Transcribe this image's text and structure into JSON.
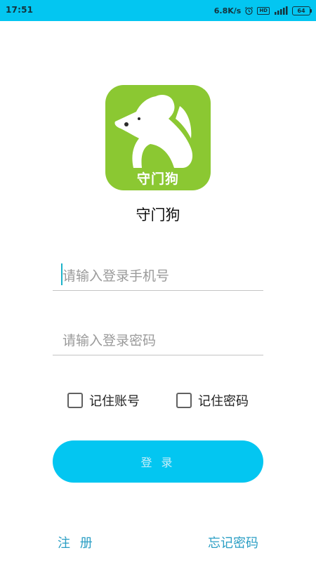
{
  "status_bar": {
    "time": "17:51",
    "network_speed": "6.8K/s",
    "hd_badge": "HD",
    "battery_level": "64",
    "color": "#03c6f1"
  },
  "logo": {
    "text": "守门狗",
    "background_color": "#8bc832",
    "icon": "dog-silhouette-icon"
  },
  "app_title": "守门狗",
  "login_form": {
    "phone_placeholder": "请输入登录手机号",
    "phone_value": "",
    "password_placeholder": "请输入登录密码",
    "password_value": "",
    "remember_account_label": "记住账号",
    "remember_account_checked": false,
    "remember_password_label": "记住密码",
    "remember_password_checked": false,
    "login_button_label": "登 录",
    "accent_color": "#03c6f1"
  },
  "footer": {
    "register_label": "注 册",
    "forgot_password_label": "忘记密码",
    "link_color": "#2a9ec4"
  }
}
